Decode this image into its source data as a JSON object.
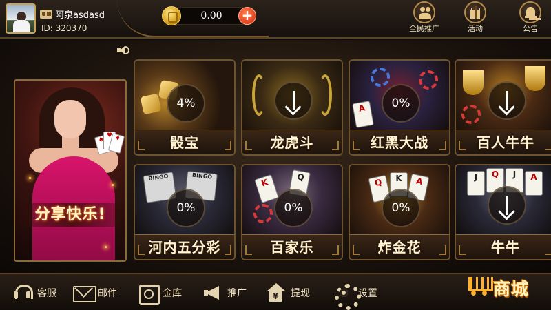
{
  "header": {
    "username": "阿泉asdasd",
    "user_id": "ID: 320370",
    "balance": "0.00",
    "add_funds_label": "+",
    "actions": [
      {
        "label": "全民推广",
        "icon": "people-icon"
      },
      {
        "label": "活动",
        "icon": "gift-icon"
      },
      {
        "label": "公告",
        "icon": "bell-icon"
      }
    ]
  },
  "promo": {
    "title": "分享快乐!"
  },
  "games": [
    {
      "name": "骰宝",
      "status_type": "progress",
      "progress_text": "4%",
      "progress": 0.04
    },
    {
      "name": "龙虎斗",
      "status_type": "download",
      "progress_text": null
    },
    {
      "name": "红黑大战",
      "status_type": "progress",
      "progress_text": "0%",
      "progress": 0
    },
    {
      "name": "百人牛牛",
      "status_type": "download",
      "progress_text": null
    },
    {
      "name": "河内五分彩",
      "status_type": "progress",
      "progress_text": "0%",
      "progress": 0
    },
    {
      "name": "百家乐",
      "status_type": "progress",
      "progress_text": "0%",
      "progress": 0
    },
    {
      "name": "炸金花",
      "status_type": "progress",
      "progress_text": "0%",
      "progress": 0
    },
    {
      "name": "牛牛",
      "status_type": "download",
      "progress_text": null
    }
  ],
  "bottom_nav": [
    {
      "label": "客服",
      "icon": "headset-icon"
    },
    {
      "label": "邮件",
      "icon": "mail-icon"
    },
    {
      "label": "金库",
      "icon": "safe-icon"
    },
    {
      "label": "推广",
      "icon": "megaphone-icon"
    },
    {
      "label": "提现",
      "icon": "withdraw-house-icon"
    },
    {
      "label": "设置",
      "icon": "gear-icon"
    }
  ],
  "shop": {
    "label": "商城",
    "icon": "cart-icon"
  },
  "colors": {
    "gold_accent": "#c9a35a",
    "background": "#1a120c",
    "add_button_red": "#d22d12",
    "shop_orange": "#ffb02e"
  }
}
